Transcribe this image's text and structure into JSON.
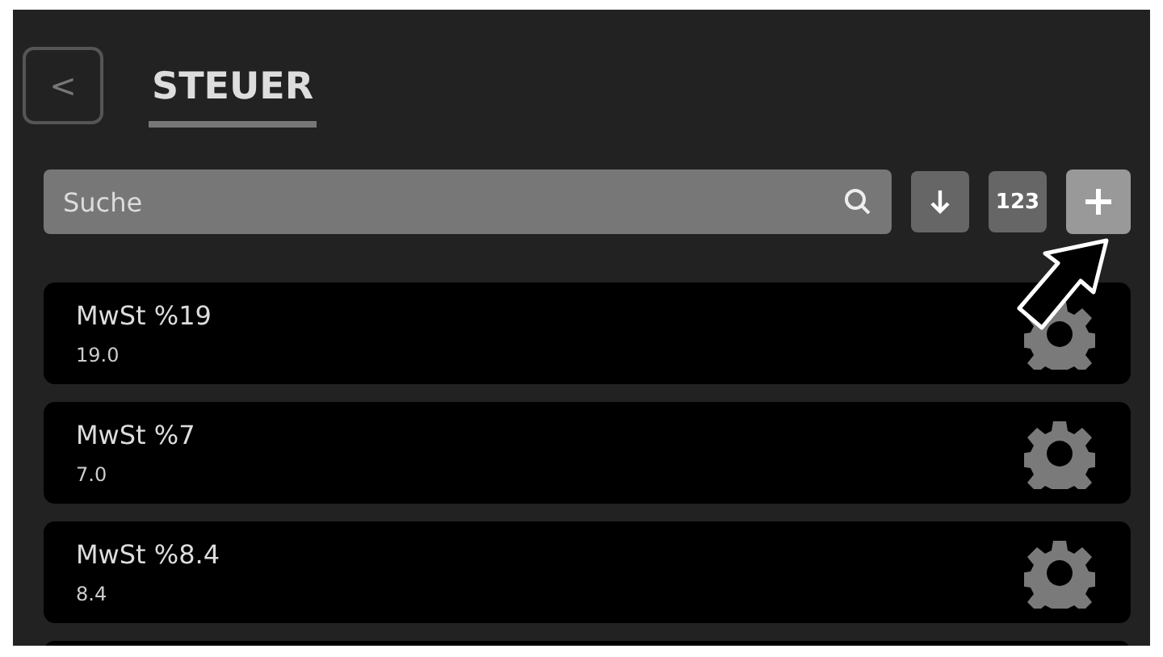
{
  "header": {
    "back_icon": "<",
    "title": "STEUER"
  },
  "toolbar": {
    "search": {
      "placeholder": "Suche"
    },
    "buttons": [
      {
        "kind": "sort"
      },
      {
        "kind": "numeric",
        "label": "123"
      },
      {
        "kind": "add"
      }
    ]
  },
  "taxes": [
    {
      "name": "MwSt %19",
      "rate": "19.0"
    },
    {
      "name": "MwSt %7",
      "rate": "7.0"
    },
    {
      "name": "MwSt %8.4",
      "rate": "8.4"
    }
  ]
}
